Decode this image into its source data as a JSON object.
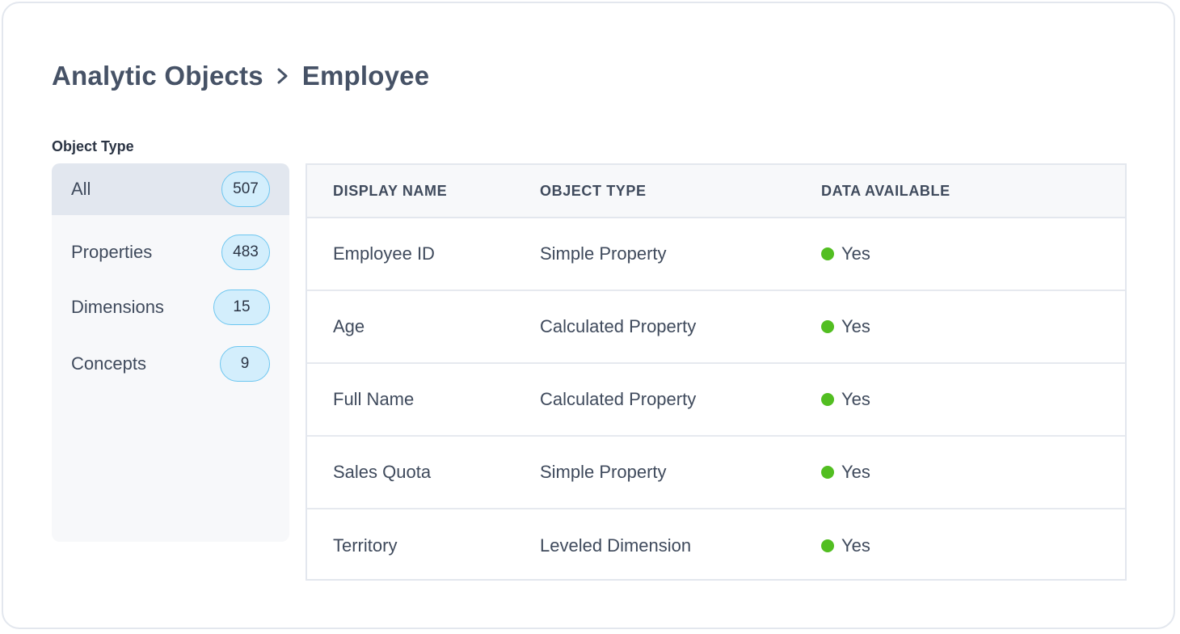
{
  "breadcrumb": {
    "parent": "Analytic Objects",
    "current": "Employee"
  },
  "filter": {
    "label": "Object Type",
    "items": [
      {
        "label": "All",
        "count": "507",
        "active": true
      },
      {
        "label": "Properties",
        "count": "483",
        "active": false
      },
      {
        "label": "Dimensions",
        "count": "15",
        "active": false
      },
      {
        "label": "Concepts",
        "count": "9",
        "active": false
      }
    ]
  },
  "table": {
    "headers": [
      "DISPLAY NAME",
      "OBJECT TYPE",
      "DATA AVAILABLE"
    ],
    "rows": [
      {
        "name": "Employee ID",
        "type": "Simple Property",
        "available": "Yes"
      },
      {
        "name": "Age",
        "type": "Calculated Property",
        "available": "Yes"
      },
      {
        "name": "Full Name",
        "type": "Calculated Property",
        "available": "Yes"
      },
      {
        "name": "Sales Quota",
        "type": "Simple Property",
        "available": "Yes"
      },
      {
        "name": "Territory",
        "type": "Leveled Dimension",
        "available": "Yes"
      }
    ]
  },
  "colors": {
    "available_dot": "#52be21",
    "badge_border": "#6cc6f0",
    "badge_fill": "#d3eefc"
  },
  "icons": {
    "breadcrumb_separator": "chevron-right-icon"
  }
}
